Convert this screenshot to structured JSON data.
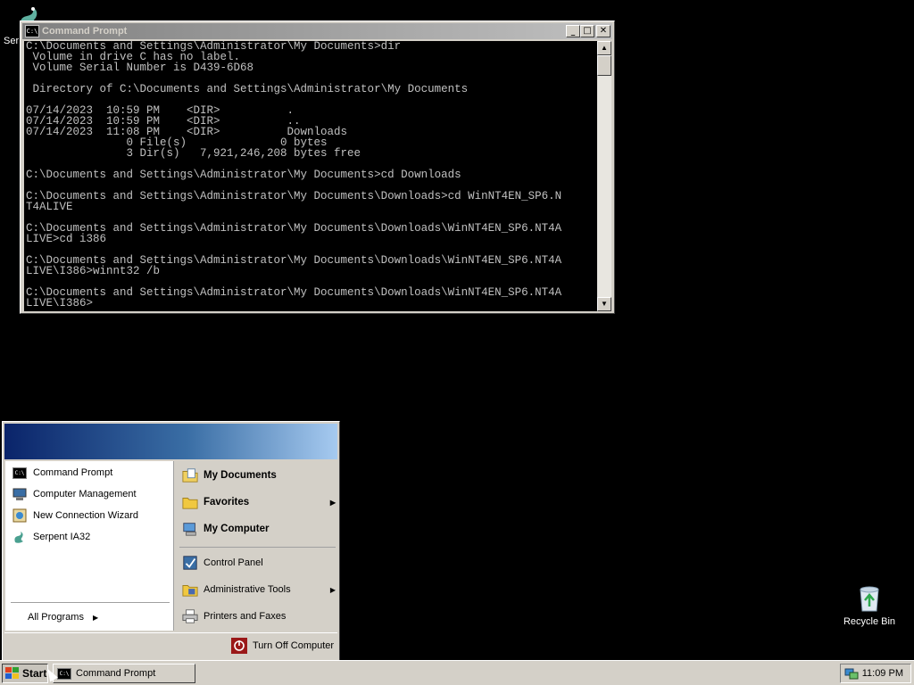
{
  "desktop": {
    "icons": [
      {
        "label": "Ser",
        "icon": "serpent-icon"
      },
      {
        "label": "Recycle Bin",
        "icon": "recycle-bin-icon"
      }
    ]
  },
  "cmd_window": {
    "title": "Command Prompt",
    "icon_text": "C:\\",
    "console_lines": [
      "C:\\Documents and Settings\\Administrator\\My Documents>dir",
      " Volume in drive C has no label.",
      " Volume Serial Number is D439-6D68",
      "",
      " Directory of C:\\Documents and Settings\\Administrator\\My Documents",
      "",
      "07/14/2023  10:59 PM    <DIR>          .",
      "07/14/2023  10:59 PM    <DIR>          ..",
      "07/14/2023  11:08 PM    <DIR>          Downloads",
      "               0 File(s)              0 bytes",
      "               3 Dir(s)   7,921,246,208 bytes free",
      "",
      "C:\\Documents and Settings\\Administrator\\My Documents>cd Downloads",
      "",
      "C:\\Documents and Settings\\Administrator\\My Documents\\Downloads>cd WinNT4EN_SP6.N",
      "T4ALIVE",
      "",
      "C:\\Documents and Settings\\Administrator\\My Documents\\Downloads\\WinNT4EN_SP6.NT4A",
      "LIVE>cd i386",
      "",
      "C:\\Documents and Settings\\Administrator\\My Documents\\Downloads\\WinNT4EN_SP6.NT4A",
      "LIVE\\I386>winnt32 /b",
      "",
      "C:\\Documents and Settings\\Administrator\\My Documents\\Downloads\\WinNT4EN_SP6.NT4A",
      "LIVE\\I386>"
    ]
  },
  "start_menu": {
    "pinned": [
      {
        "label": "Command Prompt",
        "icon": "command-prompt-icon"
      },
      {
        "label": "Computer Management",
        "icon": "computer-management-icon"
      },
      {
        "label": "New Connection Wizard",
        "icon": "connection-wizard-icon"
      },
      {
        "label": "Serpent IA32",
        "icon": "serpent-icon"
      }
    ],
    "all_programs": "All Programs",
    "right_items": [
      {
        "label": "My Documents",
        "icon": "my-documents-icon"
      },
      {
        "label": "Favorites",
        "icon": "favorites-folder-icon"
      },
      {
        "label": "My Computer",
        "icon": "my-computer-icon"
      },
      {
        "label": "Control Panel",
        "icon": "control-panel-icon"
      },
      {
        "label": "Administrative Tools",
        "icon": "administrative-tools-icon"
      },
      {
        "label": "Printers and Faxes",
        "icon": "printer-icon"
      }
    ],
    "turn_off": "Turn Off Computer"
  },
  "taskbar": {
    "start_label": "Start",
    "task_label": "Command Prompt",
    "clock": "11:09 PM"
  }
}
